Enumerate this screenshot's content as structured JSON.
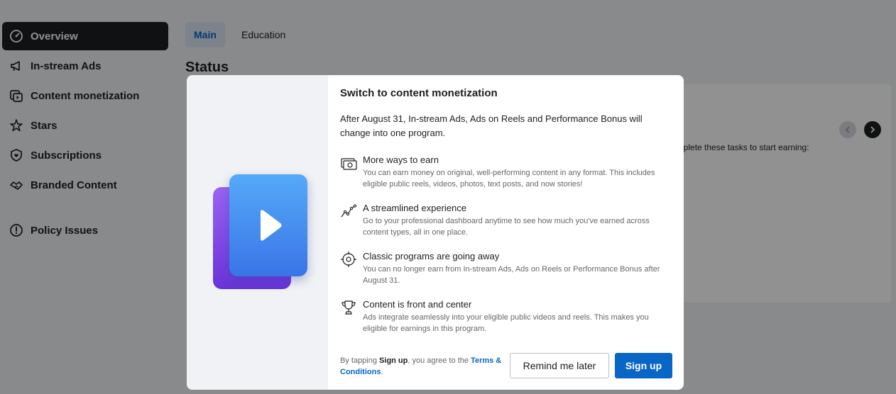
{
  "sidebar": {
    "items": [
      {
        "label": "Overview",
        "icon": "dashboard-gauge-icon",
        "active": true
      },
      {
        "label": "In-stream Ads",
        "icon": "megaphone-icon"
      },
      {
        "label": "Content monetization",
        "icon": "content-play-icon"
      },
      {
        "label": "Stars",
        "icon": "stars-icon"
      },
      {
        "label": "Subscriptions",
        "icon": "shield-heart-icon"
      },
      {
        "label": "Branded Content",
        "icon": "handshake-icon"
      },
      {
        "label": "Policy Issues",
        "icon": "alert-circle-icon"
      }
    ]
  },
  "tabs": [
    {
      "label": "Main",
      "active": true
    },
    {
      "label": "Education"
    }
  ],
  "main": {
    "status_title": "Status",
    "card_text": "nplete these tasks to start earning:"
  },
  "modal": {
    "title": "Switch to content monetization",
    "intro": "After August 31, In-stream Ads, Ads on Reels and Performance Bonus will change into one program.",
    "features": [
      {
        "icon": "money-camera-icon",
        "title": "More ways to earn",
        "desc": "You can earn money on original, well-performing content in any format. This includes eligible public reels, videos, photos, text posts, and now stories!"
      },
      {
        "icon": "trend-line-icon",
        "title": "A streamlined experience",
        "desc": "Go to your professional dashboard anytime to see how much you've earned across content types, all in one place."
      },
      {
        "icon": "target-icon",
        "title": "Classic programs are going away",
        "desc": "You can no longer earn from In-stream Ads, Ads on Reels or Performance Bonus after August 31."
      },
      {
        "icon": "trophy-icon",
        "title": "Content is front and center",
        "desc": "Ads integrate seamlessly into your eligible public videos and reels. This makes you eligible for earnings in this program."
      }
    ],
    "footer": {
      "prefix": "By tapping ",
      "bold": "Sign up",
      "middle": ", you agree to the ",
      "link": "Terms & Conditions",
      "suffix": "."
    },
    "remind_label": "Remind me later",
    "signup_label": "Sign up"
  },
  "colors": {
    "primary": "#0866c6",
    "active_nav_bg": "#1c1e21",
    "overlay": "rgba(0,0,0,0.43)"
  }
}
